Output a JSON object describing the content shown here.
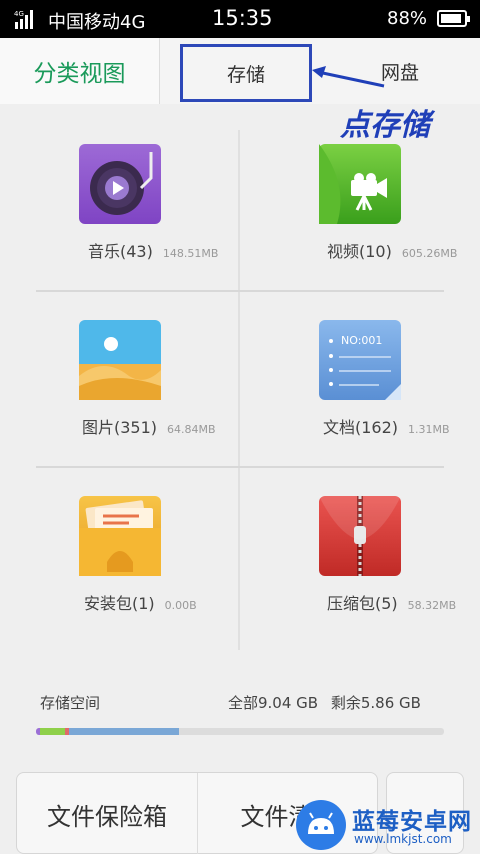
{
  "status_bar": {
    "carrier": "中国移动4G",
    "time": "15:35",
    "battery": "88%",
    "battery_level": 0.88
  },
  "tabs": [
    {
      "label": "分类视图"
    },
    {
      "label": "存储"
    },
    {
      "label": "网盘"
    }
  ],
  "annotation": "点存储",
  "categories": [
    {
      "name": "音乐(43)",
      "size": "148.51MB",
      "icon": "music-icon"
    },
    {
      "name": "视频(10)",
      "size": "605.26MB",
      "icon": "video-icon"
    },
    {
      "name": "图片(351)",
      "size": "64.84MB",
      "icon": "photo-icon"
    },
    {
      "name": "文档(162)",
      "size": "1.31MB",
      "icon": "document-icon"
    },
    {
      "name": "安装包(1)",
      "size": "0.00B",
      "icon": "apk-icon"
    },
    {
      "name": "压缩包(5)",
      "size": "58.32MB",
      "icon": "zip-icon"
    }
  ],
  "document_icon_text": "NO:001",
  "storage": {
    "label": "存储空间",
    "total": "全部9.04 GB",
    "free": "剩余5.86 GB",
    "segments": [
      {
        "color": "#9b6fd6",
        "fraction": 0.01
      },
      {
        "color": "#8fd04a",
        "fraction": 0.06
      },
      {
        "color": "#e06a6a",
        "fraction": 0.01
      },
      {
        "color": "#7aa7d6",
        "fraction": 0.27
      }
    ]
  },
  "buttons": {
    "safe": "文件保险箱",
    "clean": "文件清理"
  },
  "watermark": {
    "title": "蓝莓安卓网",
    "url": "www.lmkjst.com"
  }
}
